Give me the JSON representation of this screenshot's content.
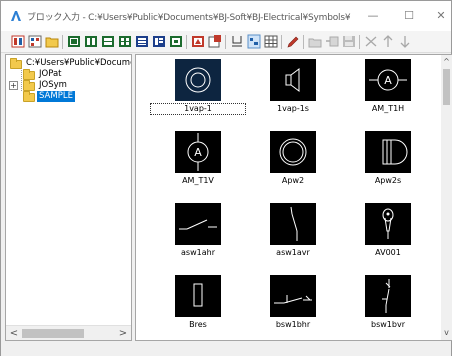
{
  "window": {
    "title": "ブロック入力 - C:¥Users¥Public¥Documents¥BJ-Soft¥BJ-Electrical¥Symbols¥",
    "minimize_glyph": "—",
    "maximize_glyph": "☐",
    "close_glyph": "✕"
  },
  "colors": {
    "selection": "#0078d7",
    "thumb_bg": "#000000",
    "selected_thumb_bg": "#0d2540",
    "folder": "#f2c94c"
  },
  "toolbar": {
    "buttons": [
      {
        "icon": "large-icons-icon"
      },
      {
        "icon": "small-icons-icon"
      },
      {
        "icon": "open-folder-icon"
      },
      {
        "icon": "grid-view-1-icon"
      },
      {
        "icon": "grid-view-2-icon"
      },
      {
        "icon": "grid-view-3-icon"
      },
      {
        "icon": "grid-view-4-icon"
      },
      {
        "icon": "grid-view-5-icon"
      },
      {
        "icon": "grid-view-6-icon"
      },
      {
        "icon": "grid-view-7-icon"
      },
      {
        "icon": "symbol-properties-icon"
      },
      {
        "icon": "symbol-settings-icon"
      },
      {
        "icon": "underline-icon"
      },
      {
        "icon": "sort-icon"
      },
      {
        "icon": "table-icon"
      },
      {
        "icon": "edit-pen-icon"
      },
      {
        "icon": "new-folder-icon"
      },
      {
        "icon": "register-icon"
      },
      {
        "icon": "save-icon"
      },
      {
        "icon": "delete-icon"
      },
      {
        "icon": "arrow-up-icon"
      },
      {
        "icon": "arrow-down-icon"
      }
    ]
  },
  "tree": {
    "root": "C:¥Users¥Public¥Document",
    "items": [
      {
        "label": "JOPat",
        "expandable": false
      },
      {
        "label": "JOSym",
        "expandable": true,
        "expander_glyph": "+"
      },
      {
        "label": "SAMPLE",
        "expandable": false,
        "selected": true
      }
    ],
    "scroll_left_glyph": "<",
    "scroll_right_glyph": ">"
  },
  "symbols": {
    "scroll_up_glyph": "^",
    "scroll_down_glyph": "v",
    "items": [
      {
        "name": "1vap-1",
        "glyph": "concentric-circles",
        "selected": true
      },
      {
        "name": "1vap-1s",
        "glyph": "speaker"
      },
      {
        "name": "AM_T1H",
        "glyph": "circle-a-h"
      },
      {
        "name": "AM_T1V",
        "glyph": "circle-a-v"
      },
      {
        "name": "Apw2",
        "glyph": "double-circle"
      },
      {
        "name": "Apw2s",
        "glyph": "speaker-box"
      },
      {
        "name": "asw1ahr",
        "glyph": "switch-h"
      },
      {
        "name": "asw1avr",
        "glyph": "switch-v"
      },
      {
        "name": "AV001",
        "glyph": "microphone"
      },
      {
        "name": "Bres",
        "glyph": "rectangle"
      },
      {
        "name": "bsw1bhr",
        "glyph": "breaker-h"
      },
      {
        "name": "bsw1bvr",
        "glyph": "breaker-v"
      }
    ]
  }
}
